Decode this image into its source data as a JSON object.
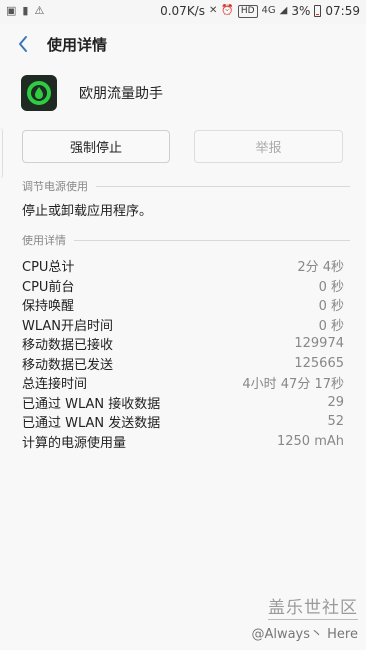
{
  "status_bar": {
    "net_speed": "0.07K/s",
    "hd": "HD",
    "signal": "4G",
    "battery": "3%",
    "time": "07:59"
  },
  "header": {
    "title": "使用详情"
  },
  "app": {
    "name": "欧朋流量助手"
  },
  "buttons": {
    "force_stop": "强制停止",
    "report": "举报"
  },
  "power_section": {
    "title": "调节电源使用",
    "text": "停止或卸载应用程序。"
  },
  "usage_section": {
    "title": "使用详情",
    "rows": [
      {
        "label": "CPU总计",
        "value": "2分 4秒"
      },
      {
        "label": "CPU前台",
        "value": "0 秒"
      },
      {
        "label": "保持唤醒",
        "value": "0 秒"
      },
      {
        "label": "WLAN开启时间",
        "value": "0 秒"
      },
      {
        "label": "移动数据已接收",
        "value": "129974"
      },
      {
        "label": "移动数据已发送",
        "value": "125665"
      },
      {
        "label": "总连接时间",
        "value": "4小时 47分 17秒"
      },
      {
        "label": "已通过 WLAN 接收数据",
        "value": "29"
      },
      {
        "label": "已通过 WLAN 发送数据",
        "value": "52"
      },
      {
        "label": "计算的电源使用量",
        "value": "1250 mAh"
      }
    ]
  },
  "watermark": {
    "logo": "盖乐世社区",
    "user": "@Always丶 Here"
  }
}
